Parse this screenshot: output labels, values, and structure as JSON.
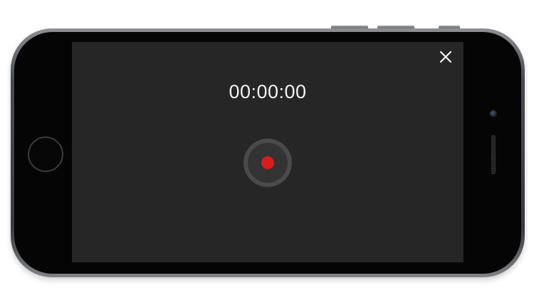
{
  "recorder": {
    "timer": "00:00:00"
  },
  "icons": {
    "close": "close-icon",
    "record": "record-dot-icon"
  },
  "colors": {
    "screen_background": "#262626",
    "record_dot": "#d71e1e",
    "timer_text": "#f2f2f2"
  }
}
